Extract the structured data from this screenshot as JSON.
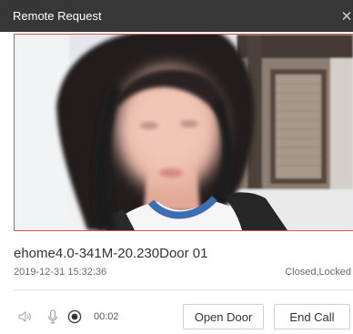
{
  "window": {
    "title": "Remote Request"
  },
  "call": {
    "device_name": "ehome4.0-341M-20.230Door 01",
    "timestamp": "2019-12-31 15:32:36",
    "door_status": "Closed,Locked",
    "elapsed_time": "00:02"
  },
  "actions": {
    "open_door_label": "Open Door",
    "end_call_label": "End Call"
  },
  "icons": {
    "close": "close-icon",
    "speaker": "speaker-icon",
    "microphone": "microphone-icon",
    "record": "record-icon"
  },
  "colors": {
    "title_bar": "#373737",
    "title_text": "#ffffff",
    "video_border": "#d9534f",
    "primary_text": "#333333",
    "secondary_text": "#6b6b6b",
    "divider": "#e2e2e2",
    "button_border": "#cfcfcf"
  }
}
